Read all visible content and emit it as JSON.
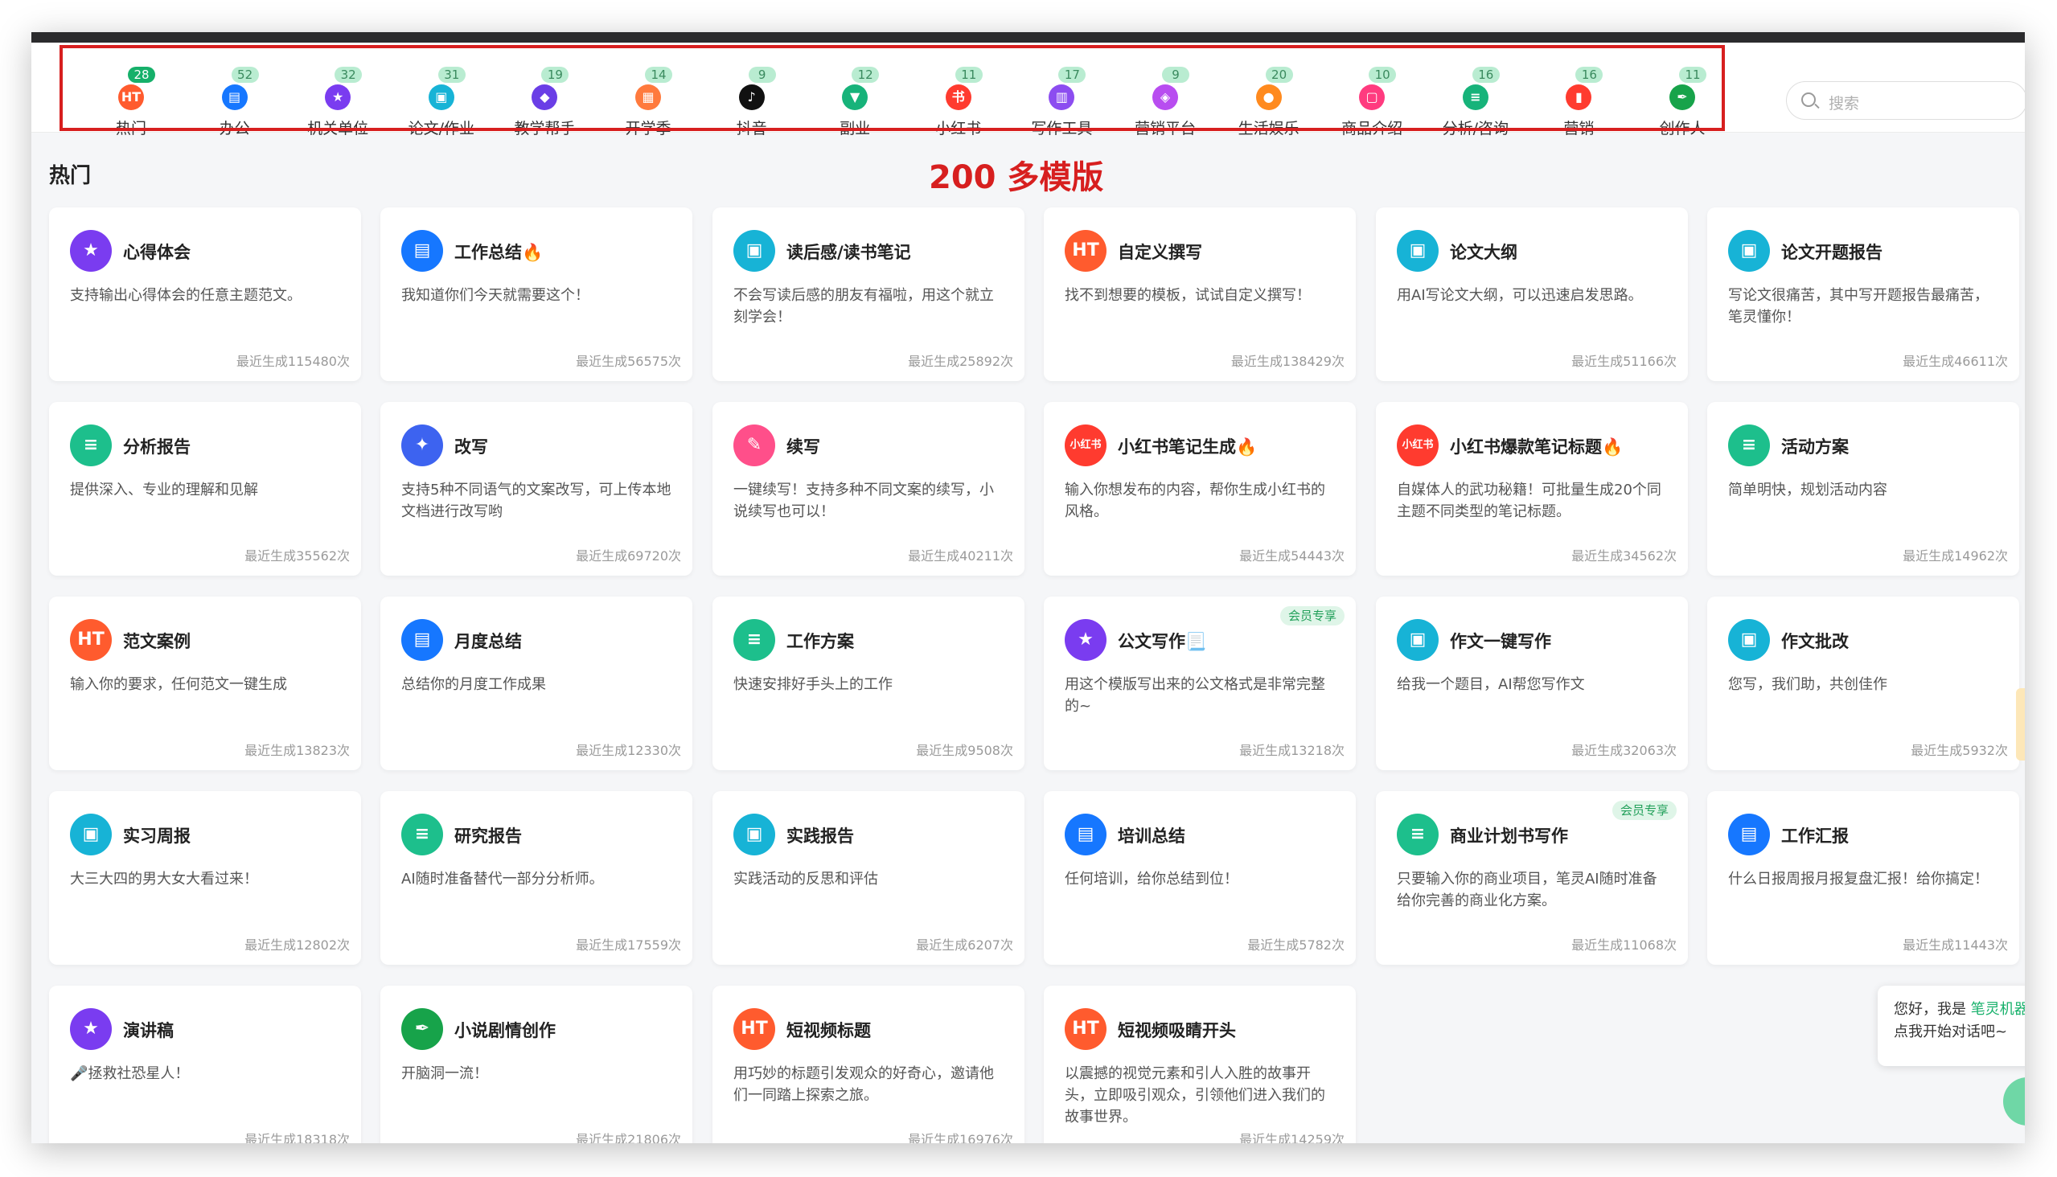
{
  "overlay_title": "200 多模版",
  "search": {
    "placeholder": "搜索"
  },
  "section_title": "热门",
  "categories": [
    {
      "label": "热门",
      "count": "28",
      "icon": "hot-icon",
      "color": "#ff5b2e"
    },
    {
      "label": "办公",
      "count": "52",
      "icon": "briefcase-icon",
      "color": "#1677ff"
    },
    {
      "label": "机关单位",
      "count": "32",
      "icon": "star-badge-icon",
      "color": "#7a3cf0"
    },
    {
      "label": "论文/作业",
      "count": "31",
      "icon": "paper-icon",
      "color": "#17b3d6"
    },
    {
      "label": "教学帮手",
      "count": "19",
      "icon": "graduation-cap-icon",
      "color": "#6a3ee6"
    },
    {
      "label": "开学季",
      "count": "14",
      "icon": "calendar-icon",
      "color": "#ff7a3d"
    },
    {
      "label": "抖音",
      "count": "9",
      "icon": "tiktok-icon",
      "color": "#111111"
    },
    {
      "label": "副业",
      "count": "12",
      "icon": "tie-icon",
      "color": "#17b37a"
    },
    {
      "label": "小红书",
      "count": "11",
      "icon": "xiaohongshu-icon",
      "color": "#ff3b2f"
    },
    {
      "label": "写作工具",
      "count": "17",
      "icon": "notebook-icon",
      "color": "#8c4df0"
    },
    {
      "label": "营销平台",
      "count": "9",
      "icon": "tag-icon",
      "color": "#b84df0"
    },
    {
      "label": "生活娱乐",
      "count": "20",
      "icon": "microphone-icon",
      "color": "#ff8a1e"
    },
    {
      "label": "商品介绍",
      "count": "10",
      "icon": "shopping-bag-icon",
      "color": "#ff3b7f"
    },
    {
      "label": "分析/咨询",
      "count": "16",
      "icon": "document-icon",
      "color": "#17b37a"
    },
    {
      "label": "营销",
      "count": "16",
      "icon": "bar-chart-icon",
      "color": "#ff3b2f"
    },
    {
      "label": "创作人",
      "count": "11",
      "icon": "pen-icon",
      "color": "#17a34a"
    }
  ],
  "cards": [
    {
      "title": "心得体会",
      "desc": "支持输出心得体会的任意主题范文。",
      "count": "最近生成115480次",
      "icon": "star-badge-icon",
      "color": "#7a3cf0",
      "glyph": "★"
    },
    {
      "title": "工作总结🔥",
      "desc": "我知道你们今天就需要这个！",
      "count": "最近生成56575次",
      "icon": "briefcase-icon",
      "color": "#1677ff",
      "glyph": "▤"
    },
    {
      "title": "读后感/读书笔记",
      "desc": "不会写读后感的朋友有福啦，用这个就立刻学会！",
      "count": "最近生成25892次",
      "icon": "paper-icon",
      "color": "#17b3d6",
      "glyph": "▣"
    },
    {
      "title": "自定义撰写",
      "desc": "找不到想要的模板，试试自定义撰写！",
      "count": "最近生成138429次",
      "icon": "hot-icon",
      "color": "#ff5b2e",
      "glyph": "HT"
    },
    {
      "title": "论文大纲",
      "desc": "用AI写论文大纲，可以迅速启发思路。",
      "count": "最近生成51166次",
      "icon": "paper-icon",
      "color": "#17b3d6",
      "glyph": "▣"
    },
    {
      "title": "论文开题报告",
      "desc": "写论文很痛苦，其中写开题报告最痛苦，笔灵懂你！",
      "count": "最近生成46611次",
      "icon": "paper-icon",
      "color": "#17b3d6",
      "glyph": "▣"
    },
    {
      "title": "分析报告",
      "desc": "提供深入、专业的理解和见解",
      "count": "最近生成35562次",
      "icon": "document-icon",
      "color": "#1dbf8c",
      "glyph": "≡"
    },
    {
      "title": "改写",
      "desc": "支持5种不同语气的文案改写，可上传本地文档进行改写哟",
      "count": "最近生成69720次",
      "icon": "magic-wand-icon",
      "color": "#3d63f0",
      "glyph": "✦"
    },
    {
      "title": "续写",
      "desc": "一键续写！支持多种不同文案的续写，小说续写也可以！",
      "count": "最近生成40211次",
      "icon": "edit-icon",
      "color": "#ff4f8a",
      "glyph": "✎"
    },
    {
      "title": "小红书笔记生成🔥",
      "desc": "输入你想发布的内容，帮你生成小红书的风格。",
      "count": "最近生成54443次",
      "icon": "xiaohongshu-icon",
      "color": "#ff3b2f",
      "glyph": "小红书"
    },
    {
      "title": "小红书爆款笔记标题🔥",
      "desc": "自媒体人的武功秘籍！可批量生成20个同主题不同类型的笔记标题。",
      "count": "最近生成34562次",
      "icon": "xiaohongshu-icon",
      "color": "#ff3b2f",
      "glyph": "小红书"
    },
    {
      "title": "活动方案",
      "desc": "简单明快，规划活动内容",
      "count": "最近生成14962次",
      "icon": "document-icon",
      "color": "#1dbf8c",
      "glyph": "≡"
    },
    {
      "title": "范文案例",
      "desc": "输入你的要求，任何范文一键生成",
      "count": "最近生成13823次",
      "icon": "hot-icon",
      "color": "#ff5b2e",
      "glyph": "HT"
    },
    {
      "title": "月度总结",
      "desc": "总结你的月度工作成果",
      "count": "最近生成12330次",
      "icon": "briefcase-icon",
      "color": "#1677ff",
      "glyph": "▤"
    },
    {
      "title": "工作方案",
      "desc": "快速安排好手头上的工作",
      "count": "最近生成9508次",
      "icon": "document-icon",
      "color": "#1dbf8c",
      "glyph": "≡"
    },
    {
      "title": "公文写作📃",
      "desc": "用这个模版写出来的公文格式是非常完整的~",
      "count": "最近生成13218次",
      "icon": "star-badge-icon",
      "color": "#7a3cf0",
      "glyph": "★",
      "vip": "会员专享"
    },
    {
      "title": "作文一键写作",
      "desc": "给我一个题目，AI帮您写作文",
      "count": "最近生成32063次",
      "icon": "paper-icon",
      "color": "#17b3d6",
      "glyph": "▣"
    },
    {
      "title": "作文批改",
      "desc": "您写，我们助，共创佳作",
      "count": "最近生成5932次",
      "icon": "paper-icon",
      "color": "#17b3d6",
      "glyph": "▣"
    },
    {
      "title": "实习周报",
      "desc": "大三大四的男大女大看过来！",
      "count": "最近生成12802次",
      "icon": "paper-icon",
      "color": "#17b3d6",
      "glyph": "▣"
    },
    {
      "title": "研究报告",
      "desc": "AI随时准备替代一部分分析师。",
      "count": "最近生成17559次",
      "icon": "document-icon",
      "color": "#1dbf8c",
      "glyph": "≡"
    },
    {
      "title": "实践报告",
      "desc": "实践活动的反思和评估",
      "count": "最近生成6207次",
      "icon": "paper-icon",
      "color": "#17b3d6",
      "glyph": "▣"
    },
    {
      "title": "培训总结",
      "desc": "任何培训，给你总结到位！",
      "count": "最近生成5782次",
      "icon": "briefcase-icon",
      "color": "#1677ff",
      "glyph": "▤"
    },
    {
      "title": "商业计划书写作",
      "desc": "只要输入你的商业项目，笔灵AI随时准备给你完善的商业化方案。",
      "count": "最近生成11068次",
      "icon": "document-icon",
      "color": "#1dbf8c",
      "glyph": "≡",
      "vip": "会员专享"
    },
    {
      "title": "工作汇报",
      "desc": "什么日报周报月报复盘汇报！给你搞定！",
      "count": "最近生成11443次",
      "icon": "briefcase-icon",
      "color": "#1677ff",
      "glyph": "▤"
    },
    {
      "title": "演讲稿",
      "desc": "🎤拯救社恐星人！",
      "count": "最近生成18318次",
      "icon": "star-badge-icon",
      "color": "#7a3cf0",
      "glyph": "★"
    },
    {
      "title": "小说剧情创作",
      "desc": "开脑洞一流！",
      "count": "最近生成21806次",
      "icon": "pen-icon",
      "color": "#17a34a",
      "glyph": "✒"
    },
    {
      "title": "短视频标题",
      "desc": "用巧妙的标题引发观众的好奇心，邀请他们一同踏上探索之旅。",
      "count": "最近生成16976次",
      "icon": "hot-icon",
      "color": "#ff5b2e",
      "glyph": "HT"
    },
    {
      "title": "短视频吸睛开头",
      "desc": "以震撼的视觉元素和引人入胜的故事开头，立即吸引观众，引领他们进入我们的故事世界。",
      "count": "最近生成14259次",
      "icon": "hot-icon",
      "color": "#ff5b2e",
      "glyph": "HT"
    }
  ],
  "chat": {
    "greeting_prefix": "您好，我是 ",
    "bot_name": "笔灵机器人",
    "line2": "点我开始对话吧~"
  }
}
